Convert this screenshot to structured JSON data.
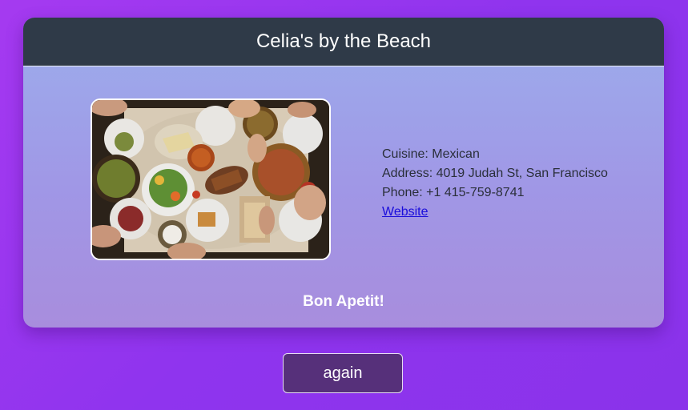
{
  "restaurant": {
    "name": "Celia's by the Beach",
    "cuisine_label": "Cuisine:",
    "cuisine": "Mexican",
    "address_label": "Address:",
    "address": "4019 Judah St, San Francisco",
    "phone_label": "Phone:",
    "phone": "+1 415-759-8741",
    "website_label": "Website",
    "photo_subject": "overhead-view-of-shared-dishes-on-table"
  },
  "greeting": "Bon Apetit!",
  "actions": {
    "again_label": "again"
  },
  "colors": {
    "page_background": "#9a38ee",
    "header_background": "#2f3a48",
    "card_gradient_top": "#9caeec",
    "card_gradient_bottom": "#a88ddd",
    "button_background": "#56307a",
    "link": "#1a0ddb"
  }
}
